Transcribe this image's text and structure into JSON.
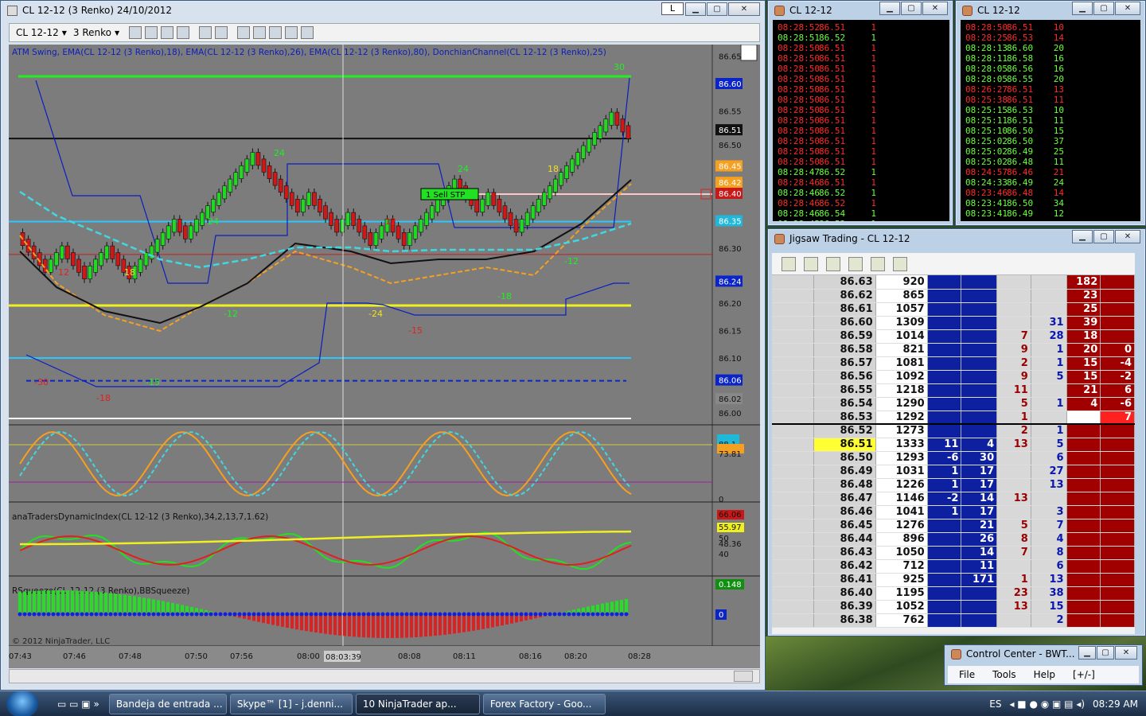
{
  "chart_win": {
    "title": "CL 12-12 (3 Renko)  24/10/2012",
    "btn_l": "L",
    "instrument": "CL 12-12",
    "period": "3 Renko",
    "indicator_label": "ATM Swing, EMA(CL 12-12 (3 Renko),18), EMA(CL 12-12 (3 Renko),26), EMA(CL 12-12 (3 Renko),80), DonchianChannel(CL 12-12 (3 Renko),25)",
    "panel2_label": "anaTradersDynamicIndex(CL 12-12 (3 Renko),34,2,13,7,1.62)",
    "panel3_label": "RSqueeze(CL 12-12 (3 Renko),BBSqueeze)",
    "copyright": "© 2012 NinjaTrader, LLC",
    "order_label": "1  Sell STP",
    "crosshair_time": "08:03:39",
    "price_axis": [
      "86.65",
      "86.60",
      "86.55",
      "86.51",
      "86.50",
      "86.45",
      "86.42",
      "86.40",
      "86.35",
      "86.30",
      "86.24",
      "86.20",
      "86.15",
      "86.10",
      "86.06",
      "86.02",
      "86.00"
    ],
    "osc_axis": [
      "100",
      "88.1",
      "73.81",
      "0"
    ],
    "tdi_axis": [
      "66.06",
      "55.97",
      "50",
      "48.36",
      "40"
    ],
    "sq_axis": [
      "0.148",
      "0"
    ],
    "time_axis": [
      "07:43",
      "07:46",
      "07:48",
      "07:50",
      "07:56",
      "08:00",
      "08:08",
      "08:11",
      "08:16",
      "08:20",
      "08:28"
    ],
    "swing_labels": [
      "24",
      "24",
      "18",
      "24",
      "18",
      "30",
      "12",
      "-12",
      "-24",
      "-15",
      "-18",
      "-12",
      "-30",
      "-18",
      "-15",
      "12"
    ]
  },
  "ts1": {
    "title": "CL 12-12",
    "rows": [
      [
        "08:28:52",
        "86.51",
        "1",
        "r"
      ],
      [
        "08:28:51",
        "86.52",
        "1",
        "g"
      ],
      [
        "08:28:50",
        "86.51",
        "1",
        "r"
      ],
      [
        "08:28:50",
        "86.51",
        "1",
        "r"
      ],
      [
        "08:28:50",
        "86.51",
        "1",
        "r"
      ],
      [
        "08:28:50",
        "86.51",
        "1",
        "r"
      ],
      [
        "08:28:50",
        "86.51",
        "1",
        "r"
      ],
      [
        "08:28:50",
        "86.51",
        "1",
        "r"
      ],
      [
        "08:28:50",
        "86.51",
        "1",
        "r"
      ],
      [
        "08:28:50",
        "86.51",
        "1",
        "r"
      ],
      [
        "08:28:50",
        "86.51",
        "1",
        "r"
      ],
      [
        "08:28:50",
        "86.51",
        "1",
        "r"
      ],
      [
        "08:28:50",
        "86.51",
        "1",
        "r"
      ],
      [
        "08:28:50",
        "86.51",
        "1",
        "r"
      ],
      [
        "08:28:47",
        "86.52",
        "1",
        "g"
      ],
      [
        "08:28:46",
        "86.51",
        "1",
        "r"
      ],
      [
        "08:28:46",
        "86.52",
        "1",
        "g"
      ],
      [
        "08:28:46",
        "86.52",
        "1",
        "r"
      ],
      [
        "08:28:46",
        "86.54",
        "1",
        "g"
      ],
      [
        "08:28:45",
        "86.53",
        "1",
        "g"
      ]
    ]
  },
  "ts2": {
    "title": "CL 12-12",
    "rows": [
      [
        "08:28:50",
        "86.51",
        "10",
        "r"
      ],
      [
        "08:28:25",
        "86.53",
        "14",
        "r"
      ],
      [
        "08:28:13",
        "86.60",
        "20",
        "g"
      ],
      [
        "08:28:11",
        "86.58",
        "16",
        "g"
      ],
      [
        "08:28:05",
        "86.56",
        "16",
        "g"
      ],
      [
        "08:28:05",
        "86.55",
        "20",
        "g"
      ],
      [
        "08:26:27",
        "86.51",
        "13",
        "r"
      ],
      [
        "08:25:38",
        "86.51",
        "11",
        "r"
      ],
      [
        "08:25:15",
        "86.53",
        "10",
        "g"
      ],
      [
        "08:25:11",
        "86.51",
        "11",
        "g"
      ],
      [
        "08:25:10",
        "86.50",
        "15",
        "g"
      ],
      [
        "08:25:02",
        "86.50",
        "37",
        "g"
      ],
      [
        "08:25:02",
        "86.49",
        "25",
        "g"
      ],
      [
        "08:25:02",
        "86.48",
        "11",
        "g"
      ],
      [
        "08:24:57",
        "86.46",
        "21",
        "r"
      ],
      [
        "08:24:33",
        "86.49",
        "24",
        "g"
      ],
      [
        "08:23:46",
        "86.48",
        "14",
        "r"
      ],
      [
        "08:23:41",
        "86.50",
        "34",
        "g"
      ],
      [
        "08:23:41",
        "86.49",
        "12",
        "g"
      ]
    ]
  },
  "jigsaw": {
    "title": "Jigsaw Trading - CL 12-12",
    "rows": [
      [
        "86.63",
        "920",
        "",
        "",
        "",
        "",
        "182",
        ""
      ],
      [
        "86.62",
        "865",
        "",
        "",
        "",
        "",
        "23",
        ""
      ],
      [
        "86.61",
        "1057",
        "",
        "",
        "",
        "",
        "25",
        ""
      ],
      [
        "86.60",
        "1309",
        "",
        "",
        "",
        "31",
        "39",
        ""
      ],
      [
        "86.59",
        "1014",
        "",
        "",
        "7",
        "28",
        "18",
        ""
      ],
      [
        "86.58",
        "821",
        "",
        "",
        "9",
        "1",
        "20",
        "0"
      ],
      [
        "86.57",
        "1081",
        "",
        "",
        "2",
        "1",
        "15",
        "-4"
      ],
      [
        "86.56",
        "1092",
        "",
        "",
        "9",
        "5",
        "15",
        "-2"
      ],
      [
        "86.55",
        "1218",
        "",
        "",
        "11",
        "",
        "21",
        "6"
      ],
      [
        "86.54",
        "1290",
        "",
        "",
        "5",
        "1",
        "4",
        "-6"
      ],
      [
        "86.53",
        "1292",
        "",
        "",
        "1",
        "",
        "2",
        "7"
      ],
      [
        "86.52",
        "1273",
        "",
        "",
        "2",
        "1",
        "",
        ""
      ],
      [
        "86.51",
        "1333",
        "11",
        "4",
        "13",
        "5",
        "",
        ""
      ],
      [
        "86.50",
        "1293",
        "-6",
        "30",
        "",
        "6",
        "",
        ""
      ],
      [
        "86.49",
        "1031",
        "1",
        "17",
        "",
        "27",
        "",
        ""
      ],
      [
        "86.48",
        "1226",
        "1",
        "17",
        "",
        "13",
        "",
        ""
      ],
      [
        "86.47",
        "1146",
        "-2",
        "14",
        "13",
        "",
        "",
        ""
      ],
      [
        "86.46",
        "1041",
        "1",
        "17",
        "",
        "3",
        "",
        ""
      ],
      [
        "86.45",
        "1276",
        "",
        "21",
        "5",
        "7",
        "",
        ""
      ],
      [
        "86.44",
        "896",
        "",
        "26",
        "8",
        "4",
        "",
        ""
      ],
      [
        "86.43",
        "1050",
        "",
        "14",
        "7",
        "8",
        "",
        ""
      ],
      [
        "86.42",
        "712",
        "",
        "11",
        "",
        "6",
        "",
        ""
      ],
      [
        "86.41",
        "925",
        "",
        "171",
        "1",
        "13",
        "",
        ""
      ],
      [
        "86.40",
        "1195",
        "",
        "",
        "23",
        "38",
        "",
        ""
      ],
      [
        "86.39",
        "1052",
        "",
        "",
        "13",
        "15",
        "",
        ""
      ],
      [
        "86.38",
        "762",
        "",
        "",
        "",
        "2",
        "",
        ""
      ]
    ]
  },
  "control_center": {
    "title": "Control Center - BWT...",
    "menu": [
      "File",
      "Tools",
      "Help",
      "[+/-]"
    ]
  },
  "taskbar": {
    "items": [
      "Bandeja de entrada ...",
      "Skype™ [1] - j.denni...",
      "10  NinjaTrader ap...",
      "Forex Factory - Goo..."
    ],
    "lang": "ES",
    "clock": "08:29 AM"
  }
}
